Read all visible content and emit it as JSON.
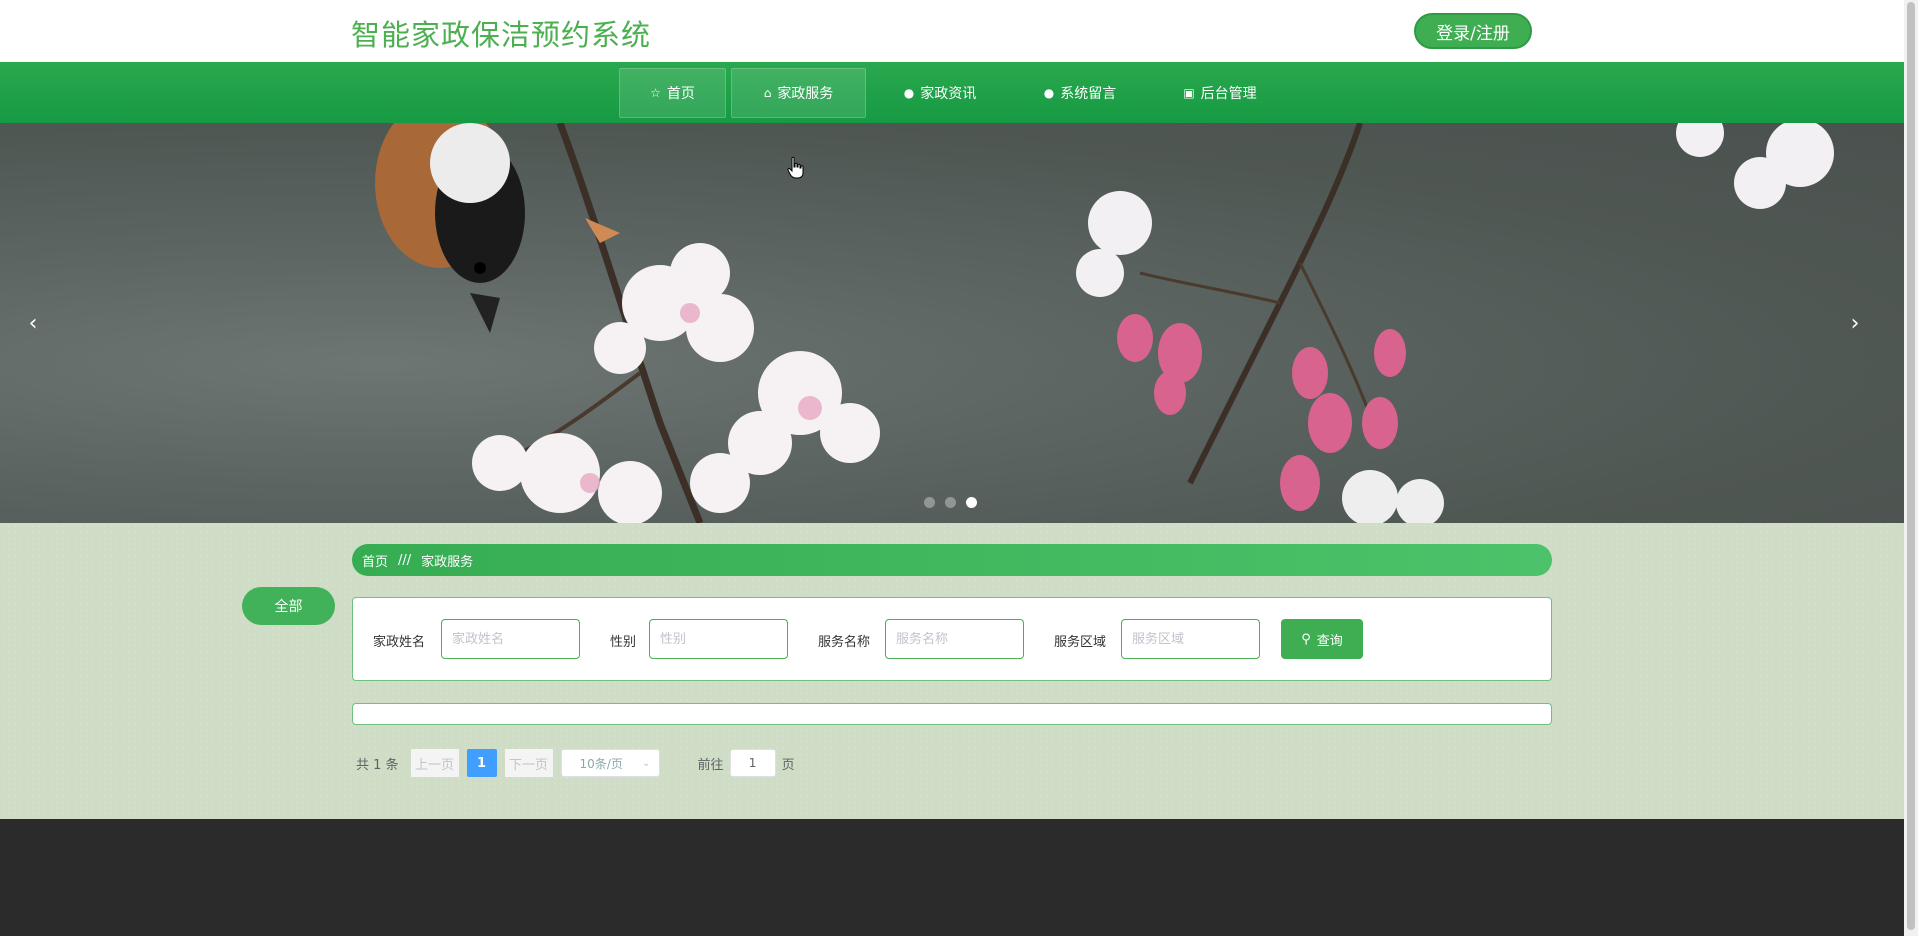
{
  "header": {
    "title": "智能家政保洁预约系统",
    "login_label": "登录/注册"
  },
  "nav": {
    "items": [
      {
        "label": "首页",
        "icon": "star-icon",
        "active": true
      },
      {
        "label": "家政服务",
        "icon": "bag-icon",
        "active": true
      },
      {
        "label": "家政资讯",
        "icon": "info-icon",
        "active": false
      },
      {
        "label": "系统留言",
        "icon": "message-icon",
        "active": false
      },
      {
        "label": "后台管理",
        "icon": "admin-icon",
        "active": false
      }
    ]
  },
  "carousel": {
    "prev": "‹",
    "next": "›",
    "active_index": 2,
    "slide_count": 3
  },
  "sidebar": {
    "all_label": "全部"
  },
  "breadcrumb": {
    "home": "首页",
    "separator": "///",
    "current": "家政服务"
  },
  "search": {
    "fields": [
      {
        "label": "家政姓名",
        "placeholder": "家政姓名"
      },
      {
        "label": "性别",
        "placeholder": "性别"
      },
      {
        "label": "服务名称",
        "placeholder": "服务名称"
      },
      {
        "label": "服务区域",
        "placeholder": "服务区域"
      }
    ],
    "query_label": "查询"
  },
  "pager": {
    "total": "共 1 条",
    "prev": "上一页",
    "page": "1",
    "next": "下一页",
    "size": "10条/页",
    "goto": "前往",
    "jump_value": "1",
    "page_unit": "页"
  },
  "colors": {
    "brand_green": "#3fae53",
    "nav_green": "#169a43",
    "footer": "#2b2b2b",
    "page_blue": "#409eff"
  }
}
